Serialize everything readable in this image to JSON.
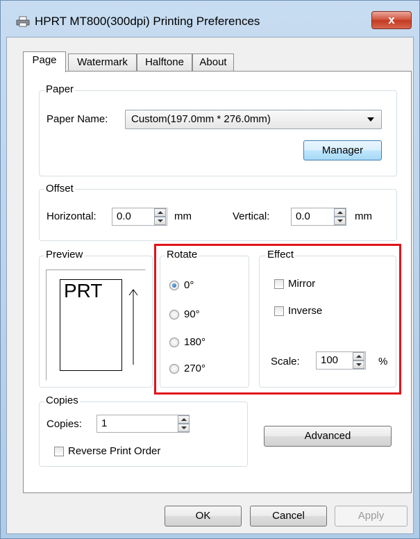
{
  "window": {
    "title": "HPRT MT800(300dpi) Printing Preferences",
    "close_label": "x"
  },
  "tabs": [
    {
      "label": "Page",
      "active": true
    },
    {
      "label": "Watermark",
      "active": false
    },
    {
      "label": "Halftone",
      "active": false
    },
    {
      "label": "About",
      "active": false
    }
  ],
  "paper": {
    "legend": "Paper",
    "name_label": "Paper Name:",
    "name_value": "Custom(197.0mm * 276.0mm)",
    "manager_label": "Manager"
  },
  "offset": {
    "legend": "Offset",
    "horizontal_label": "Horizontal:",
    "horizontal_value": "0.0",
    "vertical_label": "Vertical:",
    "vertical_value": "0.0",
    "unit": "mm"
  },
  "preview": {
    "legend": "Preview",
    "sample_text": "PRT"
  },
  "rotate": {
    "legend": "Rotate",
    "options": [
      {
        "label": "0°",
        "checked": true
      },
      {
        "label": "90°",
        "checked": false
      },
      {
        "label": "180°",
        "checked": false
      },
      {
        "label": "270°",
        "checked": false
      }
    ]
  },
  "effect": {
    "legend": "Effect",
    "mirror_label": "Mirror",
    "mirror_checked": false,
    "inverse_label": "Inverse",
    "inverse_checked": false,
    "scale_label": "Scale:",
    "scale_value": "100",
    "scale_unit": "%"
  },
  "copies": {
    "legend": "Copies",
    "label": "Copies:",
    "value": "1",
    "reverse_label": "Reverse Print Order",
    "reverse_checked": false
  },
  "buttons": {
    "advanced": "Advanced",
    "ok": "OK",
    "cancel": "Cancel",
    "apply": "Apply"
  },
  "colors": {
    "highlight": "#e0131a",
    "close_button": "#c23a22"
  }
}
